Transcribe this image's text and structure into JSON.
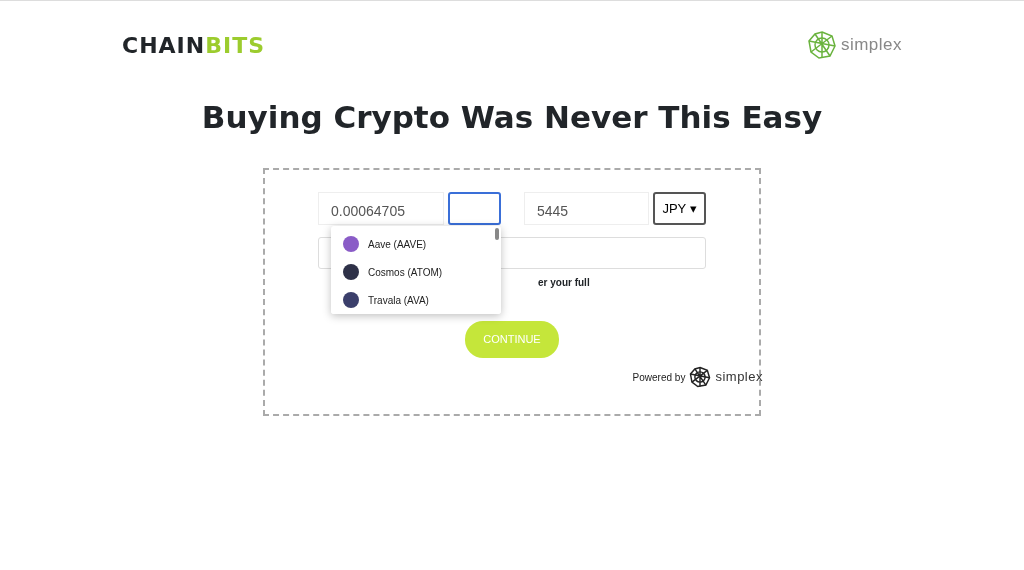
{
  "header": {
    "brand": {
      "dark_part": "CHAIN",
      "accent_part": "BITS"
    },
    "partner": "simplex"
  },
  "headline": "Buying Crypto Was Never This Easy",
  "form": {
    "crypto_amount": "0.00064705",
    "crypto_select_focused": true,
    "fiat_amount": "5445",
    "fiat_currency": "JPY",
    "caret": "▾",
    "hint_visible": "er your full",
    "dropdown": [
      {
        "name": "Aave (AAVE)",
        "color": "#8a5cc7"
      },
      {
        "name": "Cosmos (ATOM)",
        "color": "#2e3148"
      },
      {
        "name": "Travala (AVA)",
        "color": "#3b3f6b"
      }
    ],
    "continue": "CONTINUE",
    "powered_by": "Powered by",
    "powered_brand": "simplex"
  }
}
